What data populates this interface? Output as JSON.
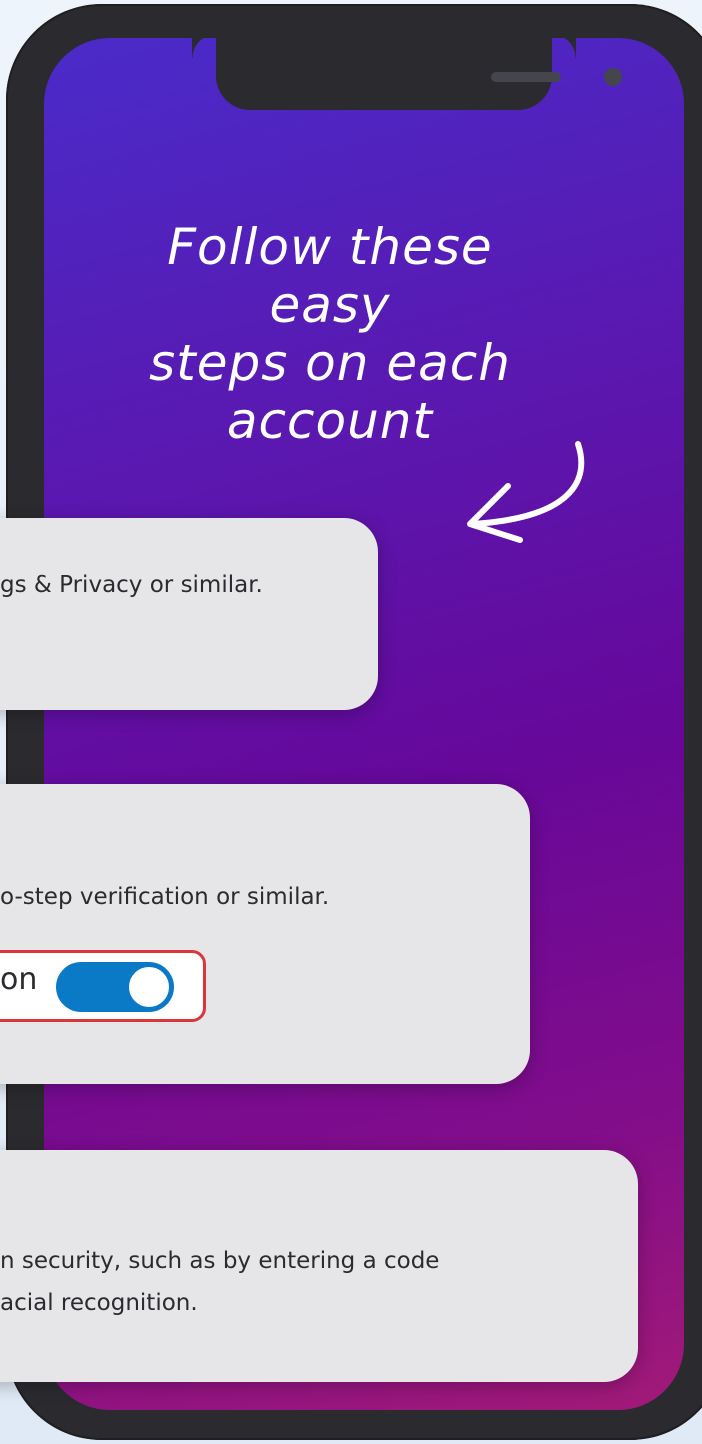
{
  "headline": {
    "line1": "Follow these easy",
    "line2": "steps on each",
    "line3": "account"
  },
  "cards": [
    {
      "text": "gs & Privacy or similar."
    },
    {
      "text": "o-step verification or similar.",
      "toggle_label": "on",
      "toggle_state": "on"
    },
    {
      "line1": "n security, such as by entering a code",
      "line2": "acial recognition."
    }
  ],
  "colors": {
    "screen_top": "#4a2bc9",
    "screen_bottom": "#a21a78",
    "card": "#e6e6e9",
    "toggle_on": "#0a7ac7",
    "highlight_border": "#d9383a"
  }
}
